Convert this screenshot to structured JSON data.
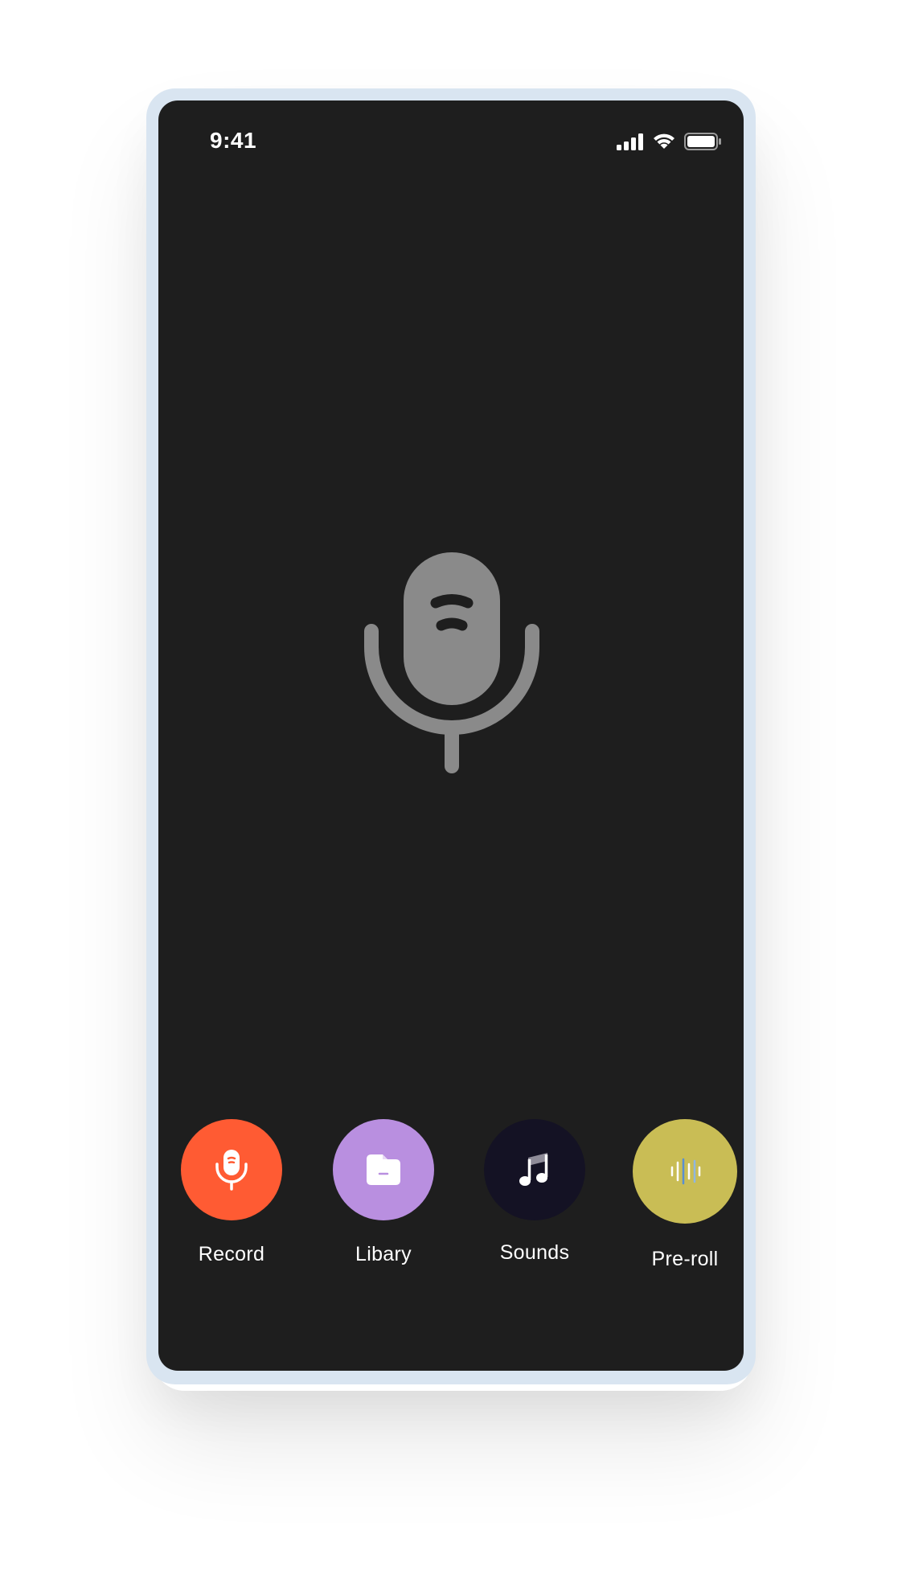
{
  "status_bar": {
    "time": "9:41",
    "signal_icon": "cellular-signal-icon",
    "wifi_icon": "wifi-icon",
    "battery_icon": "battery-icon"
  },
  "hero": {
    "icon": "microphone-icon",
    "color": "#8a8a8a"
  },
  "actions": [
    {
      "label": "Record",
      "icon": "microphone-icon",
      "color": "#ff5b33"
    },
    {
      "label": "Libary",
      "icon": "folder-icon",
      "color": "#b98fe0"
    },
    {
      "label": "Sounds",
      "icon": "music-note-icon",
      "color": "#141224"
    },
    {
      "label": "Pre-roll",
      "icon": "waveform-icon",
      "color": "#c9bd55"
    }
  ],
  "colors": {
    "screen_bg": "#1e1e1e",
    "device_frame": "#d9e5f1"
  }
}
